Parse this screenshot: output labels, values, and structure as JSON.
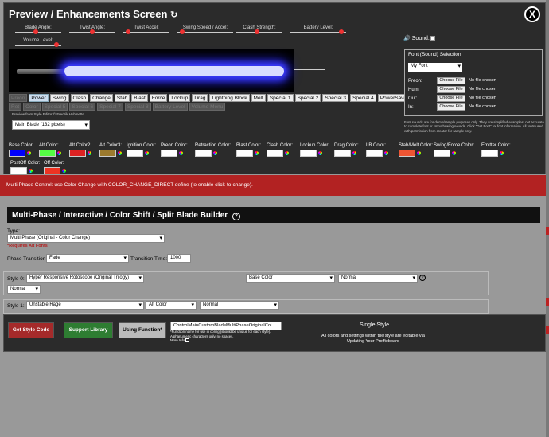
{
  "title": "Preview / Enhancements Screen",
  "refresh_icon": "refresh-icon",
  "close_label": "X",
  "sliders": [
    {
      "label": "Blade Angle:",
      "value": 0.45
    },
    {
      "label": "Twist Angle:",
      "value": 0.5
    },
    {
      "label": "Twist Accel:",
      "value": 0.05
    },
    {
      "label": "Swing Speed / Accel:",
      "value": 0.05
    },
    {
      "label": "Clash Strength:",
      "value": 0.45
    },
    {
      "label": "Battery Level:",
      "value": 0.95
    },
    {
      "label": "Volume Level:",
      "value": 0.95
    }
  ],
  "blade": {
    "color": "#3c3cff"
  },
  "effect_buttons_row1": [
    "Preon",
    "Power",
    "Swing",
    "Clash",
    "Change",
    "Stab",
    "Blast",
    "Force",
    "Lockup",
    "Drag",
    "Lightning Block",
    "Melt",
    "Special 1",
    "Special 2",
    "Special 3",
    "Special 4",
    "PowerSave"
  ],
  "effect_buttons_row2": [
    "Ret",
    "Color",
    "Special 5",
    "Special 6",
    "Special 7",
    "Special 8",
    "Battery Level",
    "Volume Menu"
  ],
  "preview_credit": "Preview from Style Editor © Fredrik Hubinette",
  "blade_select": "Main Blade (132 pixels)",
  "sound_label": "Sound:",
  "font_panel": {
    "title": "Font (Sound) Selection",
    "font_select": "My Font",
    "rows": [
      {
        "label": "Preon:",
        "button": "Choose File",
        "status": "No file chosen"
      },
      {
        "label": "Hum:",
        "button": "Choose File",
        "status": "No file chosen"
      },
      {
        "label": "Out:",
        "button": "Choose File",
        "status": "No file chosen"
      },
      {
        "label": "In:",
        "button": "Choose File",
        "status": "No file chosen"
      }
    ],
    "note": "Font sounds are for demo/sample purposes only. They are simplified examples, not accurate to complete font or smoothswing sounds. Click \"Get Font\" for font information. All fonts used with permission from creator for sample only."
  },
  "colors": [
    {
      "label": "Base Color:",
      "hex": "#0000ff"
    },
    {
      "label": "Alt Color:",
      "hex": "#55ff44"
    },
    {
      "label": "Alt Color2:",
      "hex": "#dd2222"
    },
    {
      "label": "Alt Color3:",
      "hex": "#9c7a2e"
    },
    {
      "label": "Ignition Color:",
      "hex": "#ffffff"
    },
    {
      "label": "Preon Color:",
      "hex": "#ffffff"
    },
    {
      "label": "Retraction Color:",
      "hex": "#ffffff"
    },
    {
      "label": "Blast Color:",
      "hex": "#ffffff"
    },
    {
      "label": "Clash Color:",
      "hex": "#ffffff"
    },
    {
      "label": "Lockup Color:",
      "hex": "#ffffff"
    },
    {
      "label": "Drag Color:",
      "hex": "#ffffff"
    },
    {
      "label": "LB Color:",
      "hex": "#ffffff"
    },
    {
      "label": "Stab/Melt Color:",
      "hex": "#ee5533"
    },
    {
      "label": "Swing/Force Color:",
      "hex": "#ffffff"
    },
    {
      "label": "Emitter Color:",
      "hex": "#ffffff"
    },
    {
      "label": "PostOff Color:",
      "hex": "#ffffff"
    },
    {
      "label": "Off Color:",
      "hex": "#ee3322"
    }
  ],
  "warning": "Multi Phase Control: use Color Change with COLOR_CHANGE_DIRECT define (to enable click-to-change).",
  "builder": {
    "header": "Multi-Phase / Interactive / Color Shift / Split Blade Builder",
    "help_icon": "help-icon",
    "type_label": "Type:",
    "type_value": "Multi Phase (Original - Color Change)",
    "requires_note": "*Requires Alt Fonts",
    "phase_transition_label": "Phase Transition:",
    "phase_transition_value": "Fade",
    "transition_time_label": "Transition Time:",
    "transition_time_value": "1000",
    "style0_label": "Style 0:",
    "style0_value": "Hyper Responsive Rotoscope (Original Trilogy)",
    "style0_color": "Base Color",
    "style0_mode": "Normal",
    "style0_mode2": "Normal",
    "style1_label": "Style 1:",
    "style1_value": "Unstable Rage",
    "style1_color": "Alt Color",
    "style1_mode": "Normal"
  },
  "bottom": {
    "get_style_code": "Get Style Code",
    "support_library": "Support Library",
    "using_function": "Using Function*",
    "function_name": "ControlMainCustomBladeMultiPhaseOriginalCol",
    "function_note": "*Function name for use in config (should be unique for each style). Alphanumeric characters only, no spaces.",
    "more_info": "More Info",
    "single_style": "Single Style",
    "single_note": "All colors and settings within the style are editable via Updating Your Proffieboard"
  }
}
